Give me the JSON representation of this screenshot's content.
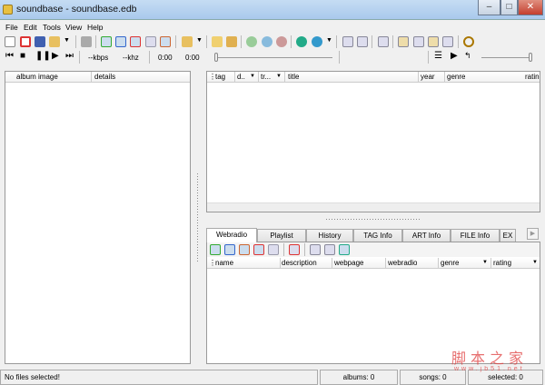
{
  "window": {
    "title": "soundbase - soundbase.edb",
    "minimize": "–",
    "maximize": "□",
    "close": "✕"
  },
  "menu": [
    "File",
    "Edit",
    "Tools",
    "View",
    "Help"
  ],
  "player": {
    "kbps": "--kbps",
    "khz": "--khz",
    "time_elapsed": "0:00",
    "time_total": "0:00",
    "position": 0,
    "volume": 1.0
  },
  "left_panel": {
    "columns": [
      "album image",
      "details"
    ]
  },
  "songs_panel": {
    "columns": [
      "tag",
      "d..",
      "tr...",
      "title",
      "year",
      "genre",
      "rating"
    ]
  },
  "tabs": [
    "Webradio",
    "Playlist",
    "History",
    "TAG Info",
    "ART Info",
    "FILE Info",
    "EX"
  ],
  "active_tab": "Webradio",
  "webradio_panel": {
    "columns": [
      "name",
      "description",
      "webpage",
      "webradio",
      "genre",
      "rating"
    ]
  },
  "status": {
    "message": "No files selected!",
    "albums": "albums: 0",
    "songs": "songs: 0",
    "selected": "selected: 0"
  },
  "watermark": {
    "line1": "脚本之家",
    "line2": "www.jb51.net"
  },
  "colors": {
    "titlebar": "#b8d3f0",
    "close": "#c94a3c"
  }
}
